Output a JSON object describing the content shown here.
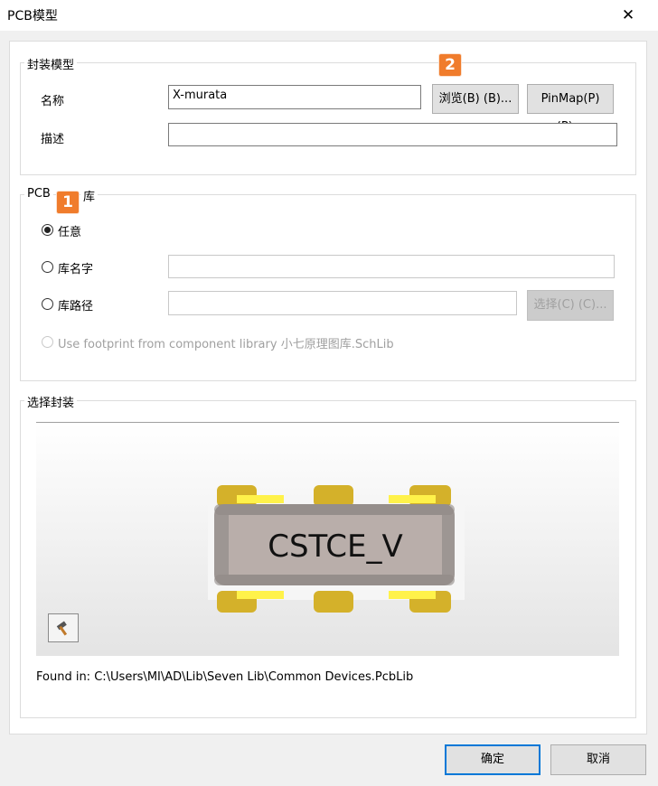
{
  "window": {
    "title": "PCB模型",
    "close_glyph": "✕"
  },
  "footprint_model": {
    "legend": "封装模型",
    "name_label": "名称",
    "name_value": "X-murata",
    "browse_label": "浏览(B) (B)...",
    "pinmap_label": "PinMap(P) (P)...",
    "description_label": "描述",
    "description_value": ""
  },
  "pcb_library": {
    "legend": "PCB",
    "legend_suffix": "库",
    "option_any": "任意",
    "option_library_name": "库名字",
    "option_library_path": "库路径",
    "select_label": "选择(C) (C)...",
    "option_use_component_library": "Use footprint from component library 小七原理图库.SchLib",
    "selected": "任意"
  },
  "selected_footprint": {
    "legend": "选择封装",
    "component_text": "CSTCE_V",
    "found_in": "Found in: C:\\Users\\MI\\AD\\Lib\\Seven Lib\\Common Devices.PcbLib",
    "tool_icon": "hammer-icon"
  },
  "badges": {
    "one": "1",
    "two": "2"
  },
  "buttons": {
    "ok": "确定",
    "cancel": "取消"
  },
  "colors": {
    "badge": "#f07c2c",
    "pad": "#d4b12a",
    "pad_highlight": "#fff24a",
    "body": "#b9aeaa",
    "primary_border": "#0078d7"
  }
}
